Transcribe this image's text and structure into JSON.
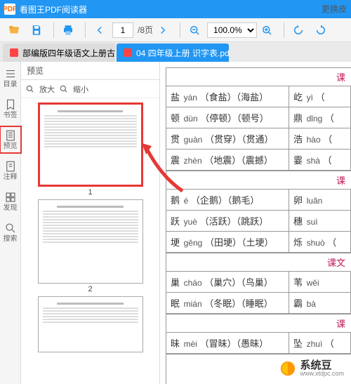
{
  "title": "看图王PDF阅读器",
  "toolbar": {
    "page_current": "1",
    "page_total": "/8页",
    "zoom": "100.0%"
  },
  "tabs": [
    {
      "label": "部编版四年级语文上册古诗背诵",
      "active": false
    },
    {
      "label": "04 四年级上册 识字表.pdf",
      "active": true
    }
  ],
  "sidebar": {
    "items": [
      {
        "id": "toc",
        "label": "目录"
      },
      {
        "id": "bookmarks",
        "label": "书签"
      },
      {
        "id": "preview",
        "label": "预览"
      },
      {
        "id": "notes",
        "label": "注释"
      },
      {
        "id": "discover",
        "label": "发现"
      },
      {
        "id": "search",
        "label": "搜索"
      }
    ]
  },
  "preview": {
    "title": "预览",
    "zoom_in": "放大",
    "zoom_out": "缩小",
    "pages": [
      "1",
      "2",
      ""
    ]
  },
  "extra": "更换皮",
  "doc": {
    "sections": [
      {
        "head": "课",
        "rows": [
          {
            "l": {
              "zi": "盐",
              "py": "yán",
              "ex": "（食盐）（海盐）"
            },
            "r": {
              "zi": "屹",
              "py": "yì",
              "ex": "（"
            }
          },
          {
            "l": {
              "zi": "顿",
              "py": "dùn",
              "ex": "（停顿）（顿号）"
            },
            "r": {
              "zi": "鼎",
              "py": "dǐng",
              "ex": "（"
            }
          },
          {
            "l": {
              "zi": "贯",
              "py": "guàn",
              "ex": "（贯穿）（贯通）"
            },
            "r": {
              "zi": "浩",
              "py": "hào",
              "ex": "（"
            }
          },
          {
            "l": {
              "zi": "震",
              "py": "zhèn",
              "ex": "（地震）（震撼）"
            },
            "r": {
              "zi": "霎",
              "py": "shà",
              "ex": "（"
            }
          }
        ]
      },
      {
        "head": "课",
        "rows": [
          {
            "l": {
              "zi": "鹅",
              "py": "é",
              "ex": "（企鹅）（鹅毛）"
            },
            "r": {
              "zi": "卵",
              "py": "luǎn",
              "ex": ""
            }
          },
          {
            "l": {
              "zi": "跃",
              "py": "yuè",
              "ex": "（活跃）（跳跃）"
            },
            "r": {
              "zi": "穗",
              "py": "suì",
              "ex": ""
            }
          },
          {
            "l": {
              "zi": "埂",
              "py": "gěng",
              "ex": "（田埂）（土埂）"
            },
            "r": {
              "zi": "烁",
              "py": "shuò",
              "ex": "（"
            }
          }
        ]
      },
      {
        "head": "课文",
        "rows": [
          {
            "l": {
              "zi": "巢",
              "py": "cháo",
              "ex": "（巢穴）（鸟巢）"
            },
            "r": {
              "zi": "苇",
              "py": "wěi",
              "ex": ""
            }
          },
          {
            "l": {
              "zi": "眠",
              "py": "mián",
              "ex": "（冬眠）（睡眠）"
            },
            "r": {
              "zi": "霸",
              "py": "bà",
              "ex": ""
            }
          }
        ]
      },
      {
        "head": "课",
        "rows": [
          {
            "l": {
              "zi": "昧",
              "py": "mèi",
              "ex": "（冒昧）（愚昧）"
            },
            "r": {
              "zi": "坠",
              "py": "zhuì",
              "ex": "（"
            }
          }
        ]
      }
    ]
  },
  "watermark": {
    "name": "系统豆",
    "url": "www.xtdpc.com"
  }
}
